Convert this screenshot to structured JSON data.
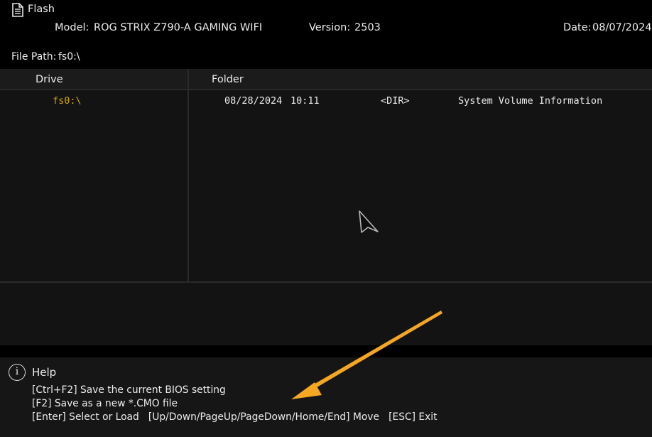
{
  "window": {
    "title": "Flash"
  },
  "info": {
    "model_label": "Model:",
    "model_value": "ROG STRIX Z790-A GAMING WIFI",
    "version_label": "Version:",
    "version_value": "2503",
    "date_label": "Date:",
    "date_value": "08/07/2024"
  },
  "file_path": {
    "label": "File Path:",
    "value": "fs0:\\"
  },
  "drive_panel": {
    "header": "Drive",
    "items": [
      "fs0:\\"
    ]
  },
  "folder_panel": {
    "header": "Folder",
    "entries": [
      {
        "date": "08/28/2024",
        "time": "10:11",
        "type": "<DIR>",
        "name": "System Volume Information"
      }
    ]
  },
  "help": {
    "title": "Help",
    "icon": "info-icon",
    "lines": [
      "[Ctrl+F2] Save the current BIOS setting",
      "[F2] Save as a new *.CMO file",
      "[Enter] Select or Load   [Up/Down/PageUp/PageDown/Home/End] Move   [ESC] Exit"
    ]
  },
  "colors": {
    "drive_highlight": "#d7a50a",
    "annotation_arrow": "#f5a623"
  }
}
